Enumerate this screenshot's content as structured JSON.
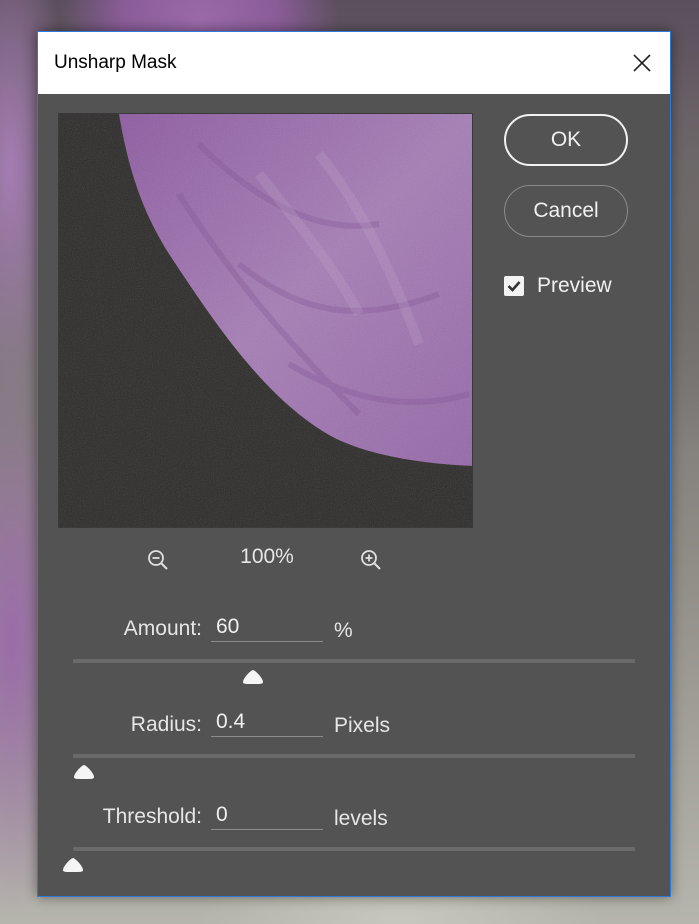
{
  "dialog": {
    "title": "Unsharp Mask",
    "close_icon": "close-icon"
  },
  "buttons": {
    "ok": "OK",
    "cancel": "Cancel"
  },
  "preview_toggle": {
    "label": "Preview",
    "checked": true
  },
  "zoom": {
    "level": "100%",
    "zoom_out_icon": "zoom-out-icon",
    "zoom_in_icon": "zoom-in-icon"
  },
  "fields": {
    "amount": {
      "label": "Amount:",
      "value": "60",
      "unit": "%",
      "slider_fraction": 0.32
    },
    "radius": {
      "label": "Radius:",
      "value": "0.4",
      "unit": "Pixels",
      "slider_fraction": 0.02
    },
    "threshold": {
      "label": "Threshold:",
      "value": "0",
      "unit": "levels",
      "slider_fraction": 0.0
    }
  },
  "colors": {
    "dialog_bg": "#535353",
    "accent_border": "#2d7bd6",
    "petal": "#9a6fad"
  }
}
